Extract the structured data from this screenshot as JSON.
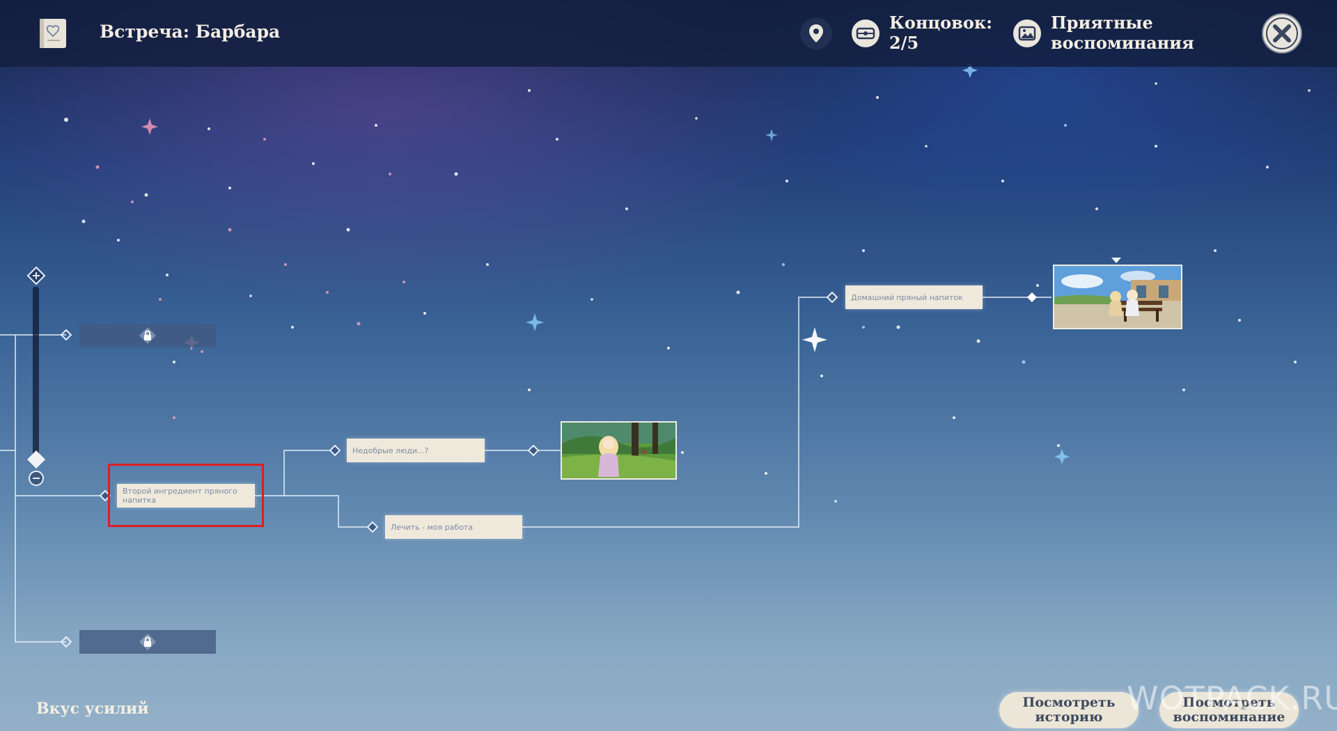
{
  "header": {
    "title": "Встреча: Барбара",
    "endings_label": "Концовок:",
    "endings_count": "2/5",
    "memories_label": "Приятные воспоминания"
  },
  "branch_nodes": {
    "second_ingredient": "Второй ингредиент пряного напитка",
    "unkind_people": "Недобрые люди...?",
    "healing_is_my_job": "Лечить - моя работа",
    "homemade_spicy_drink": "Домашний пряный напиток"
  },
  "footer": {
    "route_name": "Вкус усилий",
    "view_story_button": "Посмотреть историю",
    "view_memory_button": "Посмотреть воспоминание",
    "watermark": "WOTPACK.RU"
  },
  "icons": {
    "header": [
      "book-icon",
      "map-pin-icon",
      "ending-icon",
      "memory-image-icon",
      "close-icon"
    ],
    "tree": [
      "zoom-in-icon",
      "zoom-out-icon",
      "diamond-node-icon",
      "lock-icon"
    ]
  },
  "colors": {
    "highlight": "#e01c22",
    "node_background": "#efe9dc",
    "node_text": "#7c8ba2",
    "header_text": "#f2ede2"
  }
}
